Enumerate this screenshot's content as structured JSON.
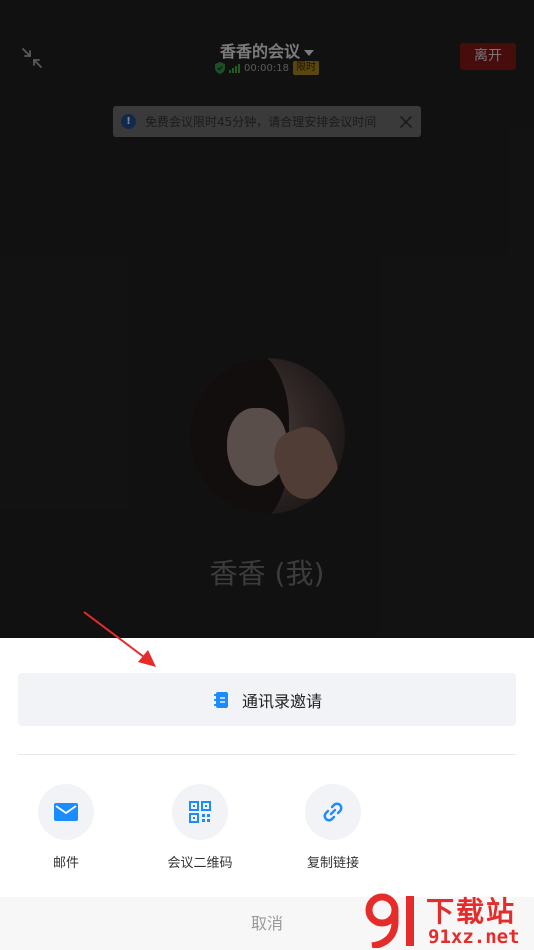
{
  "header": {
    "title": "香香的会议",
    "duration": "00:00:18",
    "badge": "限时",
    "leave_label": "离开"
  },
  "notice": {
    "message": "免费会议限时45分钟，请合理安排会议时间"
  },
  "participant": {
    "name": "香香 (我)"
  },
  "invite_sheet": {
    "contacts_label": "通讯录邀请",
    "options": [
      {
        "label": "邮件",
        "icon": "mail-icon"
      },
      {
        "label": "会议二维码",
        "icon": "qr-code-icon"
      },
      {
        "label": "复制链接",
        "icon": "link-icon"
      }
    ],
    "cancel_label": "取消"
  },
  "watermark": {
    "text_cn": "下载站",
    "text_url": "91xz.net"
  },
  "colors": {
    "accent_blue": "#1a8cff",
    "leave_red": "#6e1515",
    "annotation_red": "#e62b2b"
  }
}
